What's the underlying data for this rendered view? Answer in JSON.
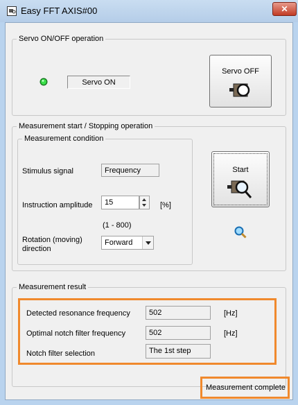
{
  "window": {
    "title": "Easy FFT AXIS#00",
    "close_label": "✕"
  },
  "servo": {
    "group_label": "Servo ON/OFF operation",
    "status_text": "Servo ON",
    "status_color": "#22cc33",
    "button_label": "Servo OFF"
  },
  "measurement": {
    "group_label": "Measurement start / Stopping operation",
    "condition_label": "Measurement condition",
    "stimulus_label": "Stimulus signal",
    "stimulus_value": "Frequency",
    "amplitude_label": "Instruction amplitude",
    "amplitude_value": "15",
    "amplitude_unit": "[%]",
    "amplitude_range": "(1 - 800)",
    "rotation_label_1": "Rotation (moving)",
    "rotation_label_2": "direction",
    "rotation_value": "Forward",
    "start_label": "Start"
  },
  "result": {
    "group_label": "Measurement result",
    "resonance_label": "Detected resonance frequency",
    "resonance_value": "502",
    "resonance_unit": "[Hz]",
    "notch_label": "Optimal notch filter frequency",
    "notch_value": "502",
    "notch_unit": "[Hz]",
    "selection_label": "Notch filter selection",
    "selection_value": "The 1st step"
  },
  "status": {
    "text": "Measurement complete"
  },
  "colors": {
    "highlight": "#f0892d",
    "titlebar": "#b9d3ee",
    "close": "#c23b25"
  }
}
